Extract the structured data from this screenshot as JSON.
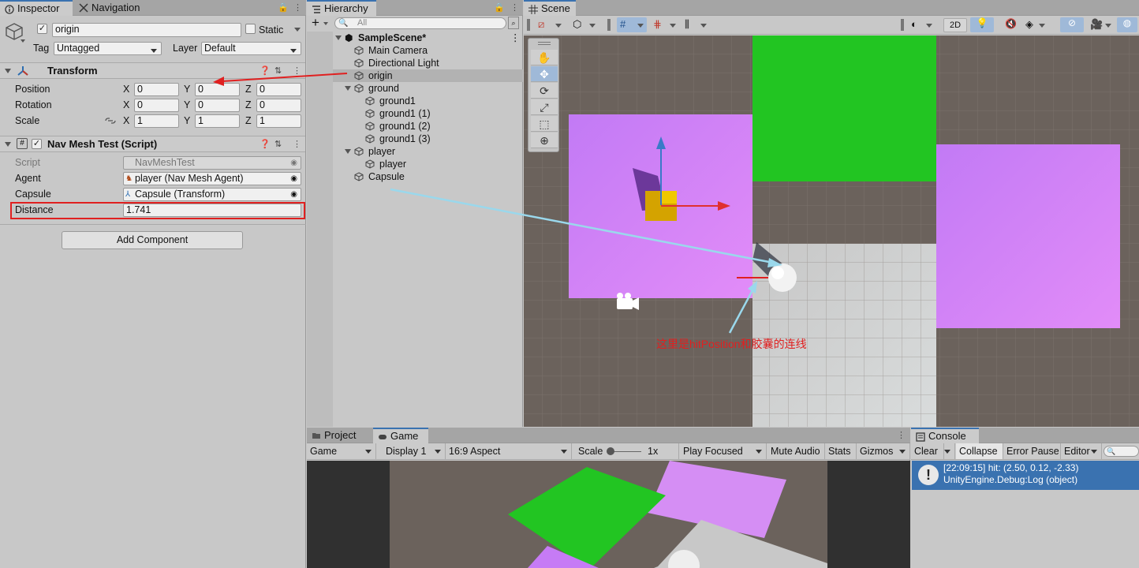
{
  "inspector": {
    "tabs": [
      {
        "label": "Inspector"
      },
      {
        "label": "Navigation"
      }
    ],
    "object_name": "origin",
    "static_label": "Static",
    "tag_label": "Tag",
    "tag_value": "Untagged",
    "layer_label": "Layer",
    "layer_value": "Default",
    "transform": {
      "title": "Transform",
      "position_label": "Position",
      "rotation_label": "Rotation",
      "scale_label": "Scale",
      "position": {
        "x": "0",
        "y": "0",
        "z": "0"
      },
      "rotation": {
        "x": "0",
        "y": "0",
        "z": "0"
      },
      "scale": {
        "x": "1",
        "y": "1",
        "z": "1"
      },
      "axis": {
        "x": "X",
        "y": "Y",
        "z": "Z"
      }
    },
    "script_component": {
      "title": "Nav Mesh Test (Script)",
      "script_label": "Script",
      "script_value": "NavMeshTest",
      "agent_label": "Agent",
      "agent_value": "player (Nav Mesh Agent)",
      "capsule_label": "Capsule",
      "capsule_value": "Capsule (Transform)",
      "distance_label": "Distance",
      "distance_value": "1.741"
    },
    "add_component": "Add Component"
  },
  "hierarchy": {
    "tab": "Hierarchy",
    "search_placeholder": "All",
    "scene_name": "SampleScene*",
    "items": [
      {
        "label": "Main Camera"
      },
      {
        "label": "Directional Light"
      },
      {
        "label": "origin"
      },
      {
        "label": "ground"
      },
      {
        "label": "ground1"
      },
      {
        "label": "ground1 (1)"
      },
      {
        "label": "ground1 (2)"
      },
      {
        "label": "ground1 (3)"
      },
      {
        "label": "player"
      },
      {
        "label": "player"
      },
      {
        "label": "Capsule"
      }
    ]
  },
  "scene": {
    "tab": "Scene",
    "mode_2d": "2D",
    "annotation": "这里是hitPosition和胶囊的连线"
  },
  "game": {
    "tabs": [
      {
        "label": "Project"
      },
      {
        "label": "Game"
      }
    ],
    "toolbar": {
      "view": "Game",
      "display": "Display 1",
      "aspect": "16:9 Aspect",
      "scale_label": "Scale",
      "scale_value": "1x",
      "play_focused": "Play Focused",
      "mute_audio": "Mute Audio",
      "stats": "Stats",
      "gizmos": "Gizmos"
    }
  },
  "console": {
    "tab": "Console",
    "clear": "Clear",
    "collapse": "Collapse",
    "error_pause": "Error Pause",
    "editor": "Editor",
    "log_line1": "[22:09:15] hit: (2.50, 0.12, -2.33)",
    "log_line2": "UnityEngine.Debug:Log (object)"
  },
  "colors": {
    "purple": "#c77dfa",
    "green": "#22c522",
    "ground_dark": "#6b625c",
    "selection_blue": "#3a72b0",
    "red_highlight": "#e02020"
  }
}
